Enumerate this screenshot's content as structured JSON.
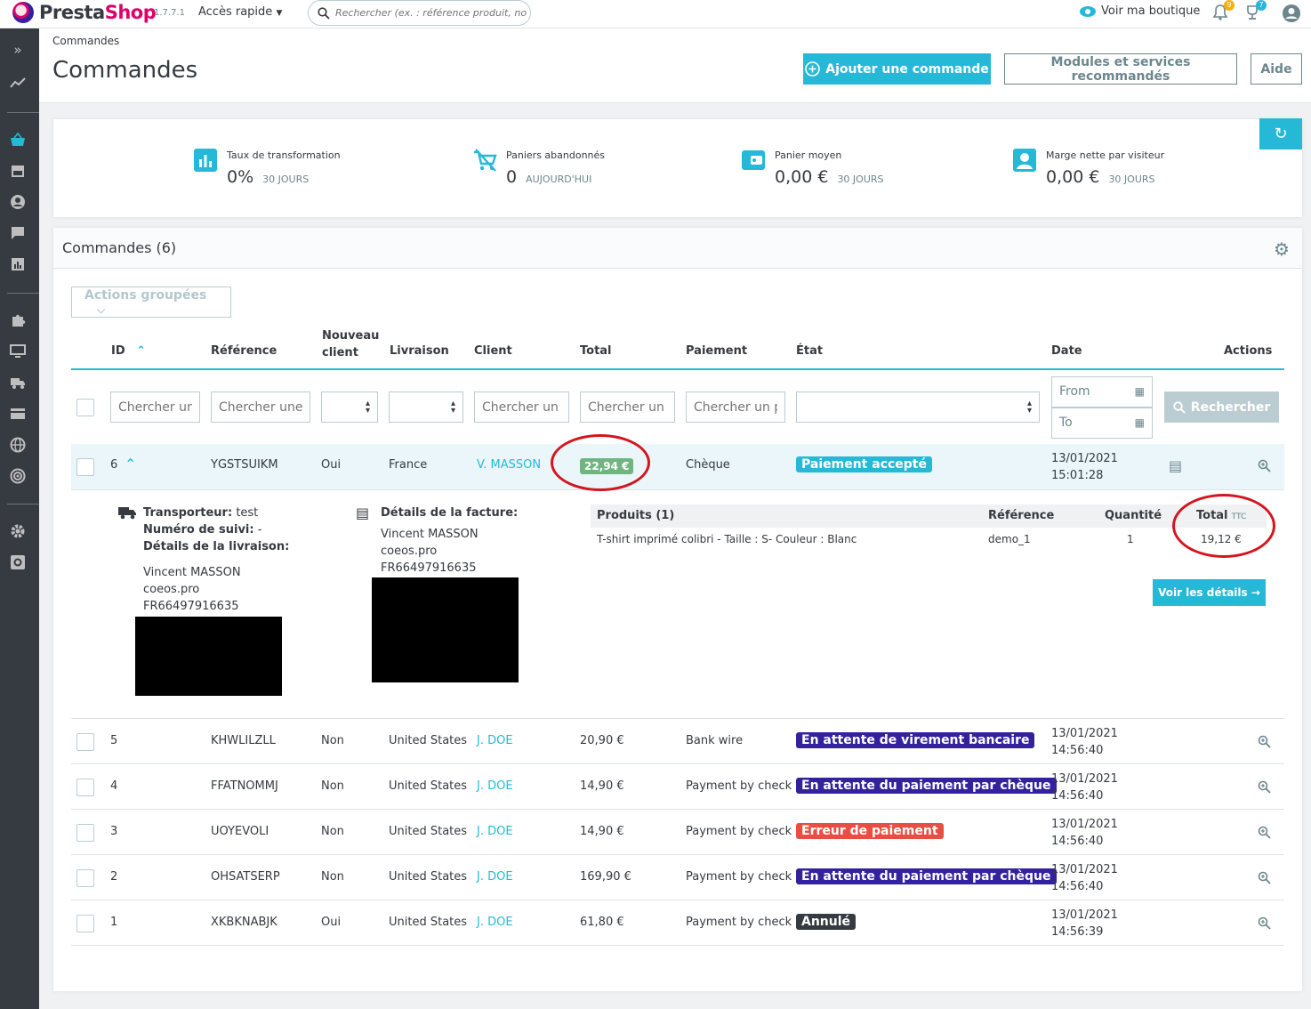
{
  "header": {
    "logo_presta": "Presta",
    "logo_shop": "Shop",
    "version": "1.7.7.1",
    "quick_access": "Accès rapide",
    "search_placeholder": "Rechercher (ex. : référence produit, nom",
    "view_shop": "Voir ma boutique",
    "notif_count": "9",
    "trophy_count": "7",
    "colors": {
      "accent": "#25b9d7",
      "brand": "#df0067"
    }
  },
  "page": {
    "breadcrumb": "Commandes",
    "title": "Commandes",
    "add_order": "Ajouter une commande",
    "modules": "Modules et services recommandés",
    "help": "Aide"
  },
  "kpis": [
    {
      "label": "Taux de transformation",
      "value": "0%",
      "period": "30 JOURS",
      "icon": "bar-chart-icon"
    },
    {
      "label": "Paniers abandonnés",
      "value": "0",
      "period": "AUJOURD'HUI",
      "icon": "remove-cart-icon"
    },
    {
      "label": "Panier moyen",
      "value": "0,00 €",
      "period": "30 JOURS",
      "icon": "wallet-icon"
    },
    {
      "label": "Marge nette par visiteur",
      "value": "0,00 €",
      "period": "30 JOURS",
      "icon": "user-icon"
    }
  ],
  "orders": {
    "title": "Commandes (6)",
    "bulk_actions": "Actions groupées",
    "columns": {
      "id": "ID",
      "reference": "Référence",
      "new_client_1": "Nouveau",
      "new_client_2": "client",
      "delivery": "Livraison",
      "client": "Client",
      "total": "Total",
      "payment": "Paiement",
      "state": "État",
      "date": "Date",
      "actions": "Actions"
    },
    "filters": {
      "id": "Chercher un",
      "reference": "Chercher une r",
      "client": "Chercher un c",
      "total": "Chercher un t",
      "payment": "Chercher un pa",
      "date_from": "From",
      "date_to": "To",
      "search": "Rechercher"
    },
    "rows": [
      {
        "id": "6",
        "ref": "YGSTSUIKM",
        "new": "Oui",
        "country": "France",
        "client": "V. MASSON",
        "total": "22,94 €",
        "payment": "Chèque",
        "state": "Paiement accepté",
        "state_color": "#25b9d7",
        "date": "13/01/2021",
        "time": "15:01:28"
      },
      {
        "id": "5",
        "ref": "KHWLILZLL",
        "new": "Non",
        "country": "United States",
        "client": "J. DOE",
        "total": "20,90 €",
        "payment": "Bank wire",
        "state": "En attente de virement bancaire",
        "state_color": "#34219e",
        "date": "13/01/2021",
        "time": "14:56:40"
      },
      {
        "id": "4",
        "ref": "FFATNOMMJ",
        "new": "Non",
        "country": "United States",
        "client": "J. DOE",
        "total": "14,90 €",
        "payment": "Payment by check",
        "state": "En attente du paiement par chèque",
        "state_color": "#34219e",
        "date": "13/01/2021",
        "time": "14:56:40"
      },
      {
        "id": "3",
        "ref": "UOYEVOLI",
        "new": "Non",
        "country": "United States",
        "client": "J. DOE",
        "total": "14,90 €",
        "payment": "Payment by check",
        "state": "Erreur de paiement",
        "state_color": "#e84e41",
        "date": "13/01/2021",
        "time": "14:56:40"
      },
      {
        "id": "2",
        "ref": "OHSATSERP",
        "new": "Non",
        "country": "United States",
        "client": "J. DOE",
        "total": "169,90 €",
        "payment": "Payment by check",
        "state": "En attente du paiement par chèque",
        "state_color": "#34219e",
        "date": "13/01/2021",
        "time": "14:56:40"
      },
      {
        "id": "1",
        "ref": "XKBKNABJK",
        "new": "Oui",
        "country": "United States",
        "client": "J. DOE",
        "total": "61,80 €",
        "payment": "Payment by check",
        "state": "Annulé",
        "state_color": "#363a41",
        "date": "13/01/2021",
        "time": "14:56:39"
      }
    ],
    "detail": {
      "carrier_label": "Transporteur:",
      "carrier_value": "test",
      "tracking_label": "Numéro de suivi:",
      "tracking_value": "-",
      "delivery_details": "Détails de la livraison:",
      "ship_name": "Vincent MASSON",
      "ship_company": "coeos.pro",
      "ship_vat": "FR66497916635",
      "invoice_label": "Détails de la facture:",
      "inv_name": "Vincent MASSON",
      "inv_company": "coeos.pro",
      "inv_vat": "FR66497916635",
      "products_header": "Produits (1)",
      "reference_header": "Référence",
      "quantity_header": "Quantité",
      "total_header": "Total",
      "ttc": "TTC",
      "product_name": "T-shirt imprimé colibri - Taille : S- Couleur : Blanc",
      "product_ref": "demo_1",
      "product_qty": "1",
      "product_total": "19,12 €",
      "view_details": "Voir les détails →"
    }
  }
}
